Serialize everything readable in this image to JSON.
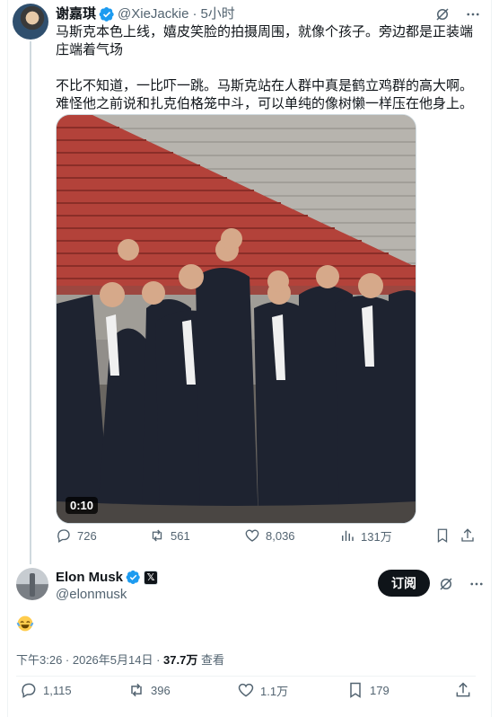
{
  "tweet1": {
    "display_name": "谢嘉琪",
    "handle": "@XieJackie",
    "separator": "·",
    "time": "5小时",
    "paragraph1": "马斯克本色上线，嬉皮笑脸的拍摄周围，就像个孩子。旁边都是正装端庄端着气场",
    "paragraph2": "不比不知道，一比吓一跳。马斯克站在人群中真是鹤立鸡群的高大啊。难怪他之前说和扎克伯格笼中斗，可以单纯的像树懒一样压在他身上。",
    "video_duration": "0:10",
    "actions": {
      "replies": "726",
      "reposts": "561",
      "likes": "8,036",
      "views": "131万"
    }
  },
  "tweet2": {
    "display_name": "Elon Musk",
    "affiliate_badge": "𝕏",
    "handle": "@elonmusk",
    "subscribe_label": "订阅",
    "body_emoji": "face-with-tears-of-joy",
    "time": "下午3:26 · 2026年5月14日 · ",
    "views_count": "37.7万",
    "views_label": " 查看",
    "actions": {
      "replies": "1,115",
      "reposts": "396",
      "likes": "1.1万",
      "bookmarks": "179"
    }
  },
  "icons": {
    "verified": "verified-badge-icon",
    "grok": "grok-icon",
    "more": "more-icon",
    "reply": "reply-icon",
    "repost": "repost-icon",
    "like": "heart-icon",
    "views": "views-icon",
    "bookmark": "bookmark-icon",
    "share": "share-icon"
  },
  "colors": {
    "verified": "#1d9bf0",
    "text": "#0f1419",
    "secondary": "#536471",
    "border": "#eff3f4",
    "stairs_red": "#b3423a"
  }
}
